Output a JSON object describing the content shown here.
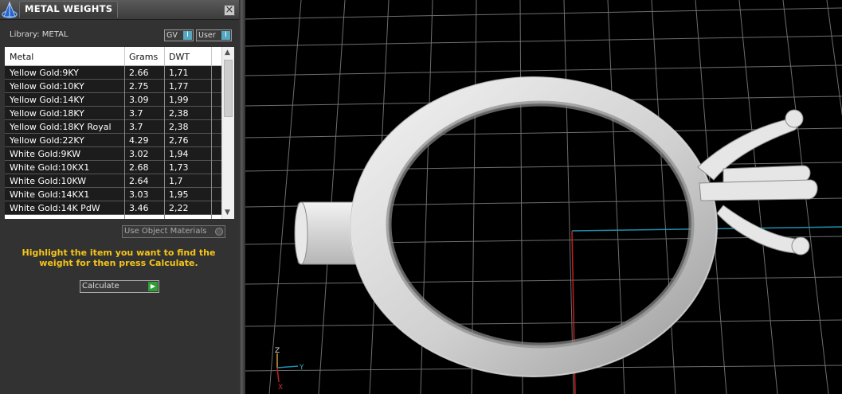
{
  "panel": {
    "title": "METAL WEIGHTS",
    "close_label": "×",
    "library_label": "Library: METAL",
    "toggles": [
      {
        "label": "GV",
        "key": "I"
      },
      {
        "label": "User",
        "key": "I"
      }
    ],
    "table": {
      "columns": [
        "Metal",
        "Grams",
        "DWT"
      ],
      "rows": [
        {
          "metal": "Yellow Gold:9KY",
          "grams": "2.66",
          "dwt": "1,71"
        },
        {
          "metal": "Yellow Gold:10KY",
          "grams": "2.75",
          "dwt": "1,77"
        },
        {
          "metal": "Yellow Gold:14KY",
          "grams": "3.09",
          "dwt": "1,99"
        },
        {
          "metal": "Yellow Gold:18KY",
          "grams": "3.7",
          "dwt": "2,38"
        },
        {
          "metal": "Yellow Gold:18KY Royal",
          "grams": "3.7",
          "dwt": "2,38"
        },
        {
          "metal": "Yellow Gold:22KY",
          "grams": "4.29",
          "dwt": "2,76"
        },
        {
          "metal": "White Gold:9KW",
          "grams": "3.02",
          "dwt": "1,94"
        },
        {
          "metal": "White Gold:10KX1",
          "grams": "2.68",
          "dwt": "1,73"
        },
        {
          "metal": "White Gold:10KW",
          "grams": "2.64",
          "dwt": "1,7"
        },
        {
          "metal": "White Gold:14KX1",
          "grams": "3.03",
          "dwt": "1,95"
        },
        {
          "metal": "White Gold:14K PdW",
          "grams": "3.46",
          "dwt": "2,22"
        }
      ]
    },
    "use_object_materials_label": "Use Object Materials",
    "instructions": "Highlight the item you want to find the weight for then press Calculate.",
    "calculate_label": "Calculate",
    "calculate_icon": "play-arrow-icon"
  },
  "viewport": {
    "axis_labels": {
      "z": "Z",
      "y": "Y",
      "x": "X"
    },
    "colors": {
      "background": "#000000",
      "grid": "#7a7a7a",
      "x_axis": "#c02020",
      "y_axis": "#1f8faa",
      "ring": "#d9d9d9",
      "instruction_text": "#f5c518"
    }
  }
}
